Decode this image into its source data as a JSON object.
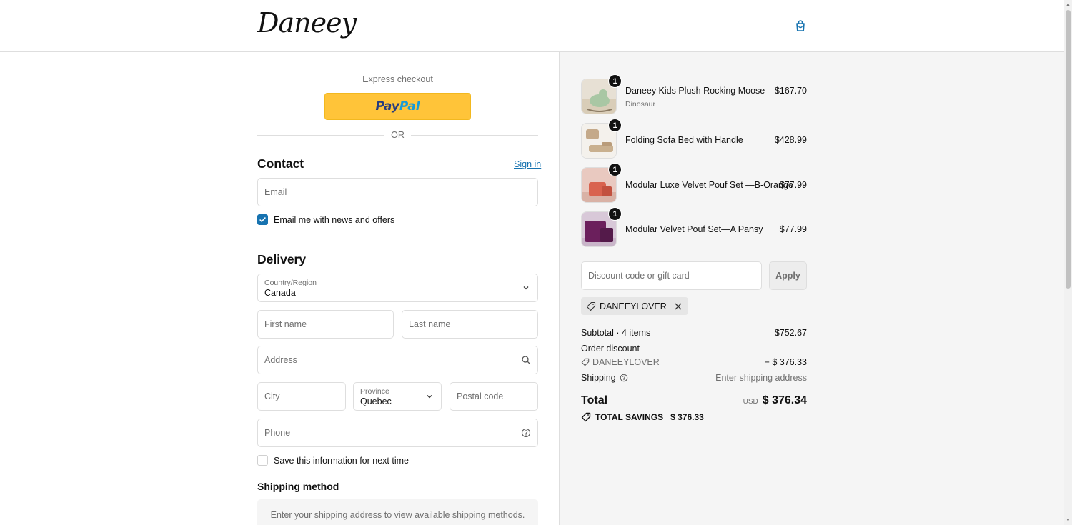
{
  "header": {
    "brand": "Daneey",
    "cart_icon": "shopping-bag-icon"
  },
  "express": {
    "title": "Express checkout",
    "paypal_part1": "Pay",
    "paypal_part2": "Pal",
    "divider": "OR"
  },
  "contact": {
    "heading": "Contact",
    "sign_in": "Sign in",
    "email_placeholder": "Email",
    "news_label": "Email me with news and offers",
    "news_checked": true
  },
  "delivery": {
    "heading": "Delivery",
    "country_label": "Country/Region",
    "country_value": "Canada",
    "first_name": "First name",
    "last_name": "Last name",
    "address": "Address",
    "city": "City",
    "province_label": "Province",
    "province_value": "Quebec",
    "postal": "Postal code",
    "phone": "Phone",
    "save_info": "Save this information for next time"
  },
  "shipping_method": {
    "heading": "Shipping method",
    "message": "Enter your shipping address to view available shipping methods."
  },
  "order": {
    "items": [
      {
        "title": "Daneey Kids Plush Rocking Moose",
        "variant": "Dinosaur",
        "price": "$167.70",
        "qty": "1"
      },
      {
        "title": "Folding Sofa Bed with Handle",
        "variant": "",
        "price": "$428.99",
        "qty": "1"
      },
      {
        "title": "Modular Luxe Velvet Pouf Set —B-Orange",
        "variant": "",
        "price": "$77.99",
        "qty": "1"
      },
      {
        "title": "Modular Velvet Pouf Set—A Pansy",
        "variant": "",
        "price": "$77.99",
        "qty": "1"
      }
    ],
    "discount_placeholder": "Discount code or gift card",
    "apply": "Apply",
    "applied_code": "DANEEYLOVER",
    "subtotal_label": "Subtotal · 4 items",
    "subtotal_value": "$752.67",
    "order_discount_label": "Order discount",
    "discount_code": "DANEEYLOVER",
    "discount_value": "− $ 376.33",
    "shipping_label": "Shipping",
    "shipping_value": "Enter shipping address",
    "total_label": "Total",
    "currency": "USD",
    "total_value": "$ 376.34",
    "savings_label": "TOTAL SAVINGS",
    "savings_value": "$ 376.33"
  },
  "colors": {
    "accent": "#1773b0",
    "paypal_yellow": "#ffc439",
    "aside_bg": "#f5f5f5"
  }
}
